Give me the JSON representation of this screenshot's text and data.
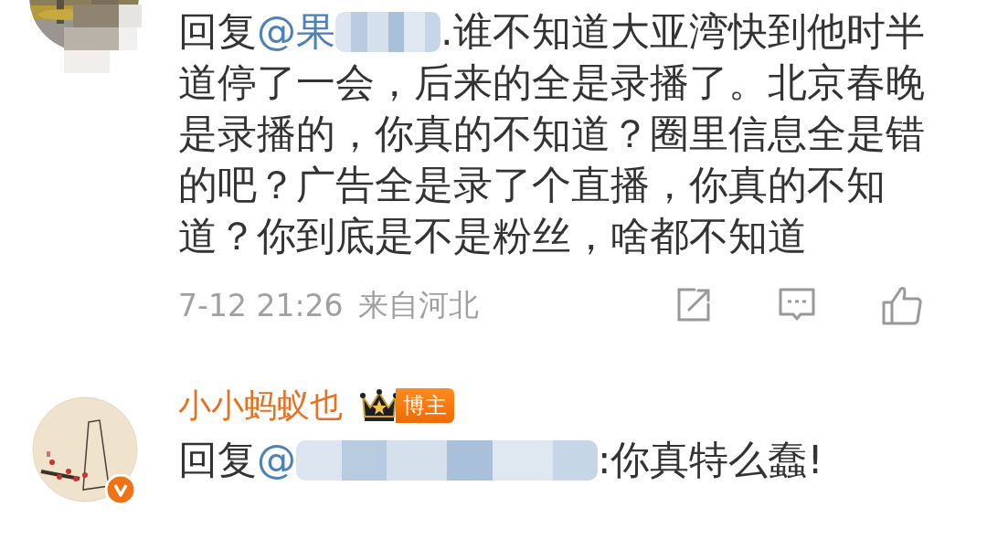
{
  "comments": [
    {
      "avatar": {
        "kind": "picture",
        "mosaic": true
      },
      "reply_label": "回复",
      "mention": "@果",
      "mention_blurred": true,
      "body": ".谁不知道大亚湾快到他时半道停了一会，后来的全是录播了。北京春晚是录播的，你真的不知道？圈里信息全是错的吧？广告全是录了个直播，你真的不知道？你到底是不是粉丝，啥都不知道",
      "time": "7-12 21:26",
      "location": "来自河北",
      "actions": [
        {
          "kind": "share"
        },
        {
          "kind": "comment"
        },
        {
          "kind": "like"
        }
      ]
    },
    {
      "avatar": {
        "kind": "picture",
        "verified": true
      },
      "author": "小小蚂蚁也",
      "badge": "博主",
      "reply_label": "回复",
      "mention": "@",
      "mention_blurred": true,
      "body": ":你真特么蠢!"
    }
  ]
}
